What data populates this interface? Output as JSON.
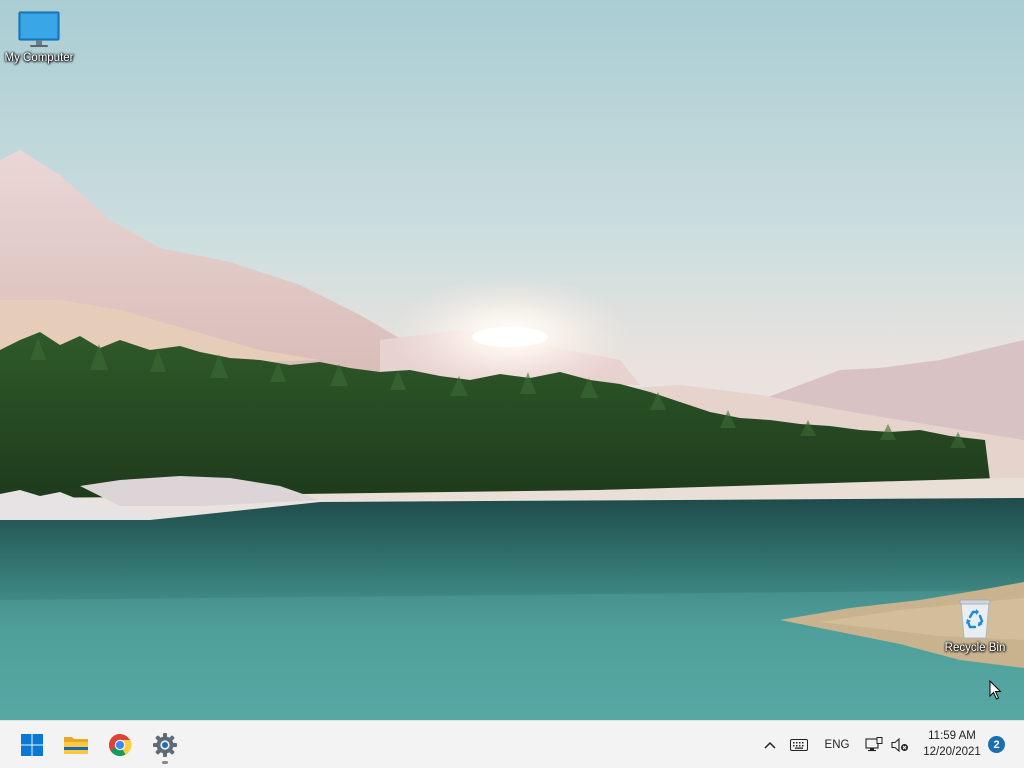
{
  "desktop": {
    "icons": [
      {
        "label": "My Computer",
        "icon": "monitor-icon"
      },
      {
        "label": "Recycle Bin",
        "icon": "recycle-bin-icon"
      }
    ]
  },
  "taskbar": {
    "apps": [
      {
        "icon": "windows-start-icon",
        "running": false
      },
      {
        "icon": "file-explorer-icon",
        "running": false
      },
      {
        "icon": "chrome-icon",
        "running": false
      },
      {
        "icon": "settings-gear-icon",
        "running": true
      }
    ],
    "tray": {
      "language": "ENG",
      "icons": [
        "chevron-up-icon",
        "keyboard-icon",
        "network-icon",
        "speaker-muted-icon"
      ]
    },
    "clock": {
      "time": "11:59 AM",
      "date": "12/20/2021"
    },
    "notification_count": "2"
  },
  "colors": {
    "taskbar_bg": "#f3f3f3",
    "accent": "#1a6fb0",
    "windows_logo": "#0a78d4"
  }
}
